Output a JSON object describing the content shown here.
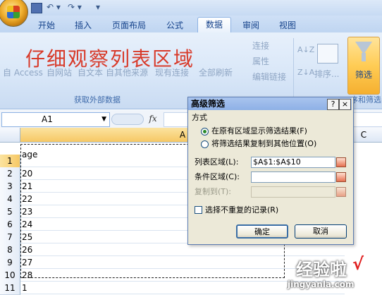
{
  "qat": {
    "save_icon": "floppy-icon",
    "undo": "↶ ▾",
    "redo": "↷ ▾",
    "customize": "▾"
  },
  "tabs": [
    {
      "label": "开始"
    },
    {
      "label": "插入"
    },
    {
      "label": "页面布局"
    },
    {
      "label": "公式"
    },
    {
      "label": "数据",
      "active": true
    },
    {
      "label": "审阅"
    },
    {
      "label": "视图"
    }
  ],
  "ribbon": {
    "overlay_title": "仔细观察列表区域",
    "access": "自 Access",
    "web": "自网站",
    "text": "自文本",
    "other": "自其他来源",
    "existing": "现有连接",
    "refresh_all": "全部刷新",
    "connections": "连接",
    "properties": "属性",
    "edit_links": "编辑链接",
    "sort_az": "A↓Z",
    "sort_za": "Z↓A",
    "sort": "排序...",
    "filter": "筛选",
    "group_external": "获取外部数据",
    "group_sort_filter": "序和筛选"
  },
  "formula_bar": {
    "name_box": "A1",
    "fx": "fx",
    "value": ""
  },
  "grid": {
    "col_a": "A",
    "col_c": "C",
    "rows": [
      {
        "num": "1",
        "value": "age"
      },
      {
        "num": "2",
        "value": "20"
      },
      {
        "num": "3",
        "value": "21"
      },
      {
        "num": "4",
        "value": "22"
      },
      {
        "num": "5",
        "value": "23"
      },
      {
        "num": "6",
        "value": "24"
      },
      {
        "num": "7",
        "value": "25"
      },
      {
        "num": "8",
        "value": "26"
      },
      {
        "num": "9",
        "value": "27"
      },
      {
        "num": "10",
        "value": "28"
      },
      {
        "num": "11",
        "value": "1"
      }
    ]
  },
  "dialog": {
    "title": "高级筛选",
    "help": "?",
    "close": "×",
    "mode_label": "方式",
    "option_in_place": "在原有区域显示筛选结果(F)",
    "option_copy": "将筛选结果复制到其他位置(O)",
    "list_range_label": "列表区域(L):",
    "list_range_value": "$A$1:$A$10",
    "criteria_label": "条件区域(C):",
    "criteria_value": "",
    "copy_to_label": "复制到(T):",
    "copy_to_value": "",
    "unique_label": "选择不重复的记录(R)",
    "ok": "确定",
    "cancel": "取消"
  },
  "watermark": {
    "text": "经验啦",
    "check": "√",
    "url": "jingyanla.com"
  },
  "colors": {
    "accent": "#15428b",
    "overlay_red": "#d83a2a",
    "active_header": "#f6c864"
  }
}
